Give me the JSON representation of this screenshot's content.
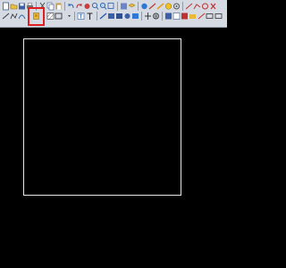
{
  "app": {
    "accent_highlight": "#e02020",
    "toolbar_bg": "#d6dbe3",
    "canvas_bg": "#000000",
    "shape_stroke": "#e8e8e8"
  },
  "toolbar": {
    "row1_icons": [
      "new-icon",
      "open-icon",
      "save-icon",
      "print-icon",
      "cut-icon",
      "copy-icon",
      "paste-icon",
      "undo-icon",
      "redo-icon",
      "pan-icon",
      "zoom-in-icon",
      "zoom-out-icon",
      "zoom-window-icon",
      "properties-icon",
      "layer-icon",
      "color-icon",
      "linetype-icon",
      "lineweight-icon",
      "help-icon",
      "settings-icon"
    ],
    "row2_icons": [
      "line-icon",
      "polyline-icon",
      "arc-icon",
      "rectangle-icon",
      "block-icon",
      "hatch-icon",
      "text-icon",
      "mtext-icon",
      "dimension-icon",
      "move-icon",
      "rotate-icon",
      "scale-icon",
      "copy-object-icon",
      "mirror-icon",
      "offset-icon",
      "trim-icon",
      "extend-icon",
      "fillet-icon",
      "erase-icon",
      "explode-icon"
    ],
    "highlighted_icon": "block-icon"
  },
  "canvas": {
    "shape": "rectangle"
  }
}
